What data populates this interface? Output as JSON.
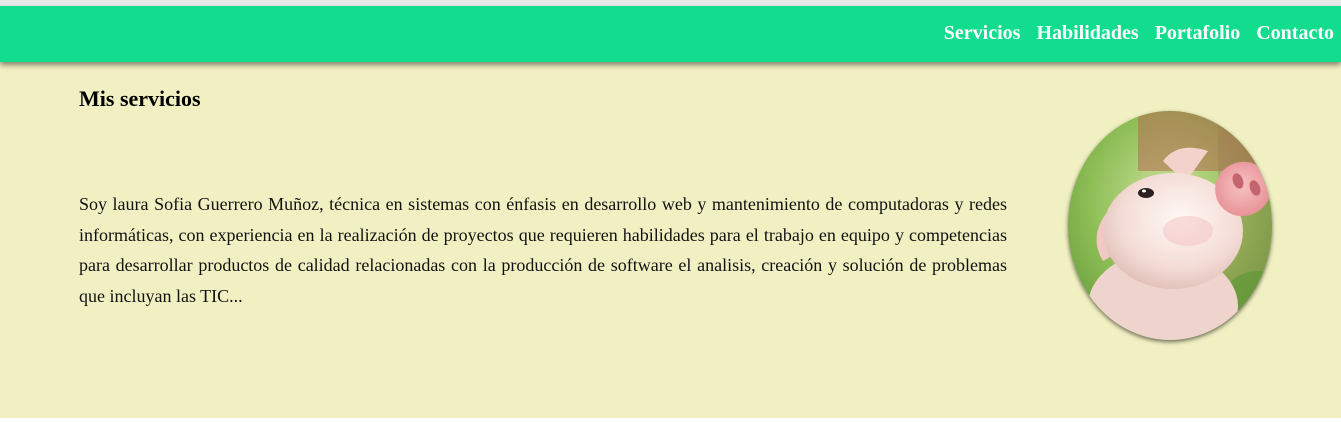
{
  "nav": {
    "links": [
      "Servicios",
      "Habilidades",
      "Portafolio",
      "Contacto"
    ]
  },
  "main": {
    "title": "Mis servicios",
    "bio": "Soy laura Sofia Guerrero Muñoz, técnica en sistemas con énfasis en desarrollo web y mantenimiento de computadoras y redes informáticas, con experiencia en la realización de proyectos que requieren habilidades para el trabajo en equipo y competencias para desarrollar productos de calidad relacionadas con la producción de software el analisis, creación y solución de problemas que incluyan las TIC...",
    "avatar_icon": "piglet-photo"
  },
  "colors": {
    "navbar": "#12dd8f",
    "section_bg": "#f1f0c2",
    "nav_text": "#ffffff"
  }
}
